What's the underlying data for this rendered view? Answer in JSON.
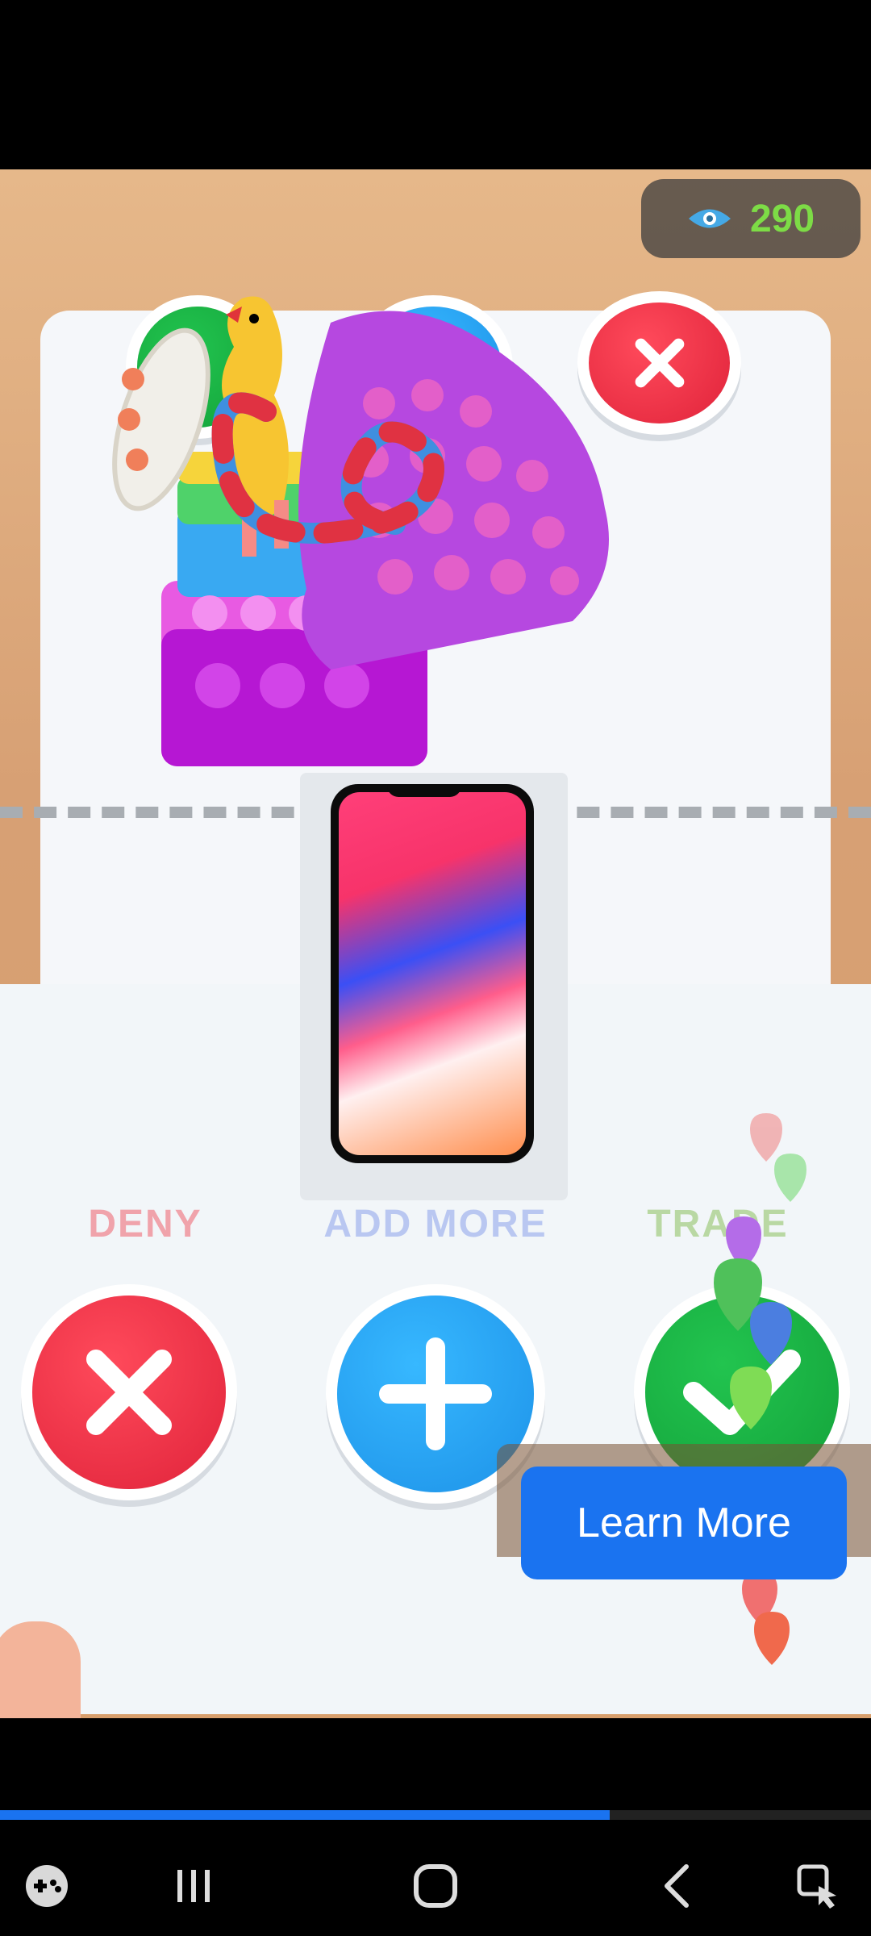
{
  "counter": {
    "icon": "eye-icon",
    "value": "290"
  },
  "top_buttons": [
    "add-icon",
    "close-icon"
  ],
  "labels": {
    "deny": "DENY",
    "add_more": "ADD MORE",
    "trade": "TRADE"
  },
  "colors": {
    "deny": "#e0233a",
    "add": "#1d92e8",
    "trade": "#13a23a",
    "cta": "#1a73f0",
    "counter": "#7ddc46"
  },
  "cta": {
    "label": "Learn More"
  },
  "progress": {
    "fraction": 0.7
  },
  "navbar": [
    "game-icon",
    "recent-apps-icon",
    "home-icon",
    "back-icon",
    "screenshot-icon"
  ]
}
